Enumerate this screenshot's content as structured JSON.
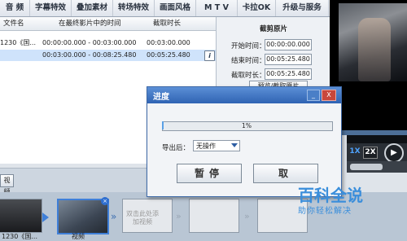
{
  "tabs": [
    "音 频",
    "字幕特效",
    "叠加素材",
    "转场特效",
    "画面风格",
    "M T V",
    "卡拉OK",
    "升级与服务"
  ],
  "table": {
    "headers": [
      "文件名",
      "在最终影片中的时间",
      "截取时长"
    ],
    "rows": [
      {
        "name": "1230《国...",
        "time": "00:00:00.000 - 00:03:00.000",
        "dur": "00:03:00.000"
      },
      {
        "name": "",
        "time": "00:03:00.000 - 00:08:25.480",
        "dur": "00:05:25.480"
      }
    ],
    "info_icon": "i"
  },
  "clip": {
    "title": "截剪原片",
    "start_label": "开始时间：",
    "start_value": "00:00:00.000",
    "end_label": "结束时间：",
    "end_value": "00:05:25.480",
    "dur_label": "截取时长：",
    "dur_value": "00:05:25.480",
    "button": "预览/截取原片"
  },
  "player": {
    "speed1": "1X",
    "speed2": "2X",
    "play_icon": "play-icon"
  },
  "bottom": {
    "video_button": "视频"
  },
  "timeline": {
    "items": [
      {
        "label": "1230《国..."
      },
      {
        "label": "视频"
      }
    ],
    "add_text": "双击此处添加视频"
  },
  "dialog": {
    "title": "进度",
    "min": "_",
    "close": "X",
    "progress_value": 0.01,
    "progress_text": "1%",
    "export_label": "导出后：",
    "export_value": "无操作",
    "pause": "暂停",
    "cancel": "取"
  },
  "watermark": {
    "text": "百科全说",
    "sub": "助你轻松解决"
  },
  "colors": {
    "accent": "#2f63b3",
    "progress": "#5aa0e6",
    "watermark": "#3a8edb"
  }
}
